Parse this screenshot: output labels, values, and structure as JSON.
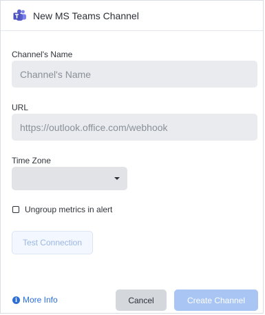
{
  "dialog": {
    "title": "New MS Teams Channel",
    "icon": "ms-teams-logo-icon"
  },
  "form": {
    "channel_name": {
      "label": "Channel's Name",
      "value": "",
      "placeholder": "Channel's Name"
    },
    "url": {
      "label": "URL",
      "value": "",
      "placeholder": "https://outlook.office.com/webhook"
    },
    "time_zone": {
      "label": "Time Zone",
      "selected": ""
    },
    "ungroup_metrics": {
      "label": "Ungroup metrics in alert",
      "checked": false
    },
    "test_connection_label": "Test Connection"
  },
  "footer": {
    "more_info_label": "More Info",
    "more_info_icon": "info-icon",
    "cancel_label": "Cancel",
    "create_label": "Create Channel"
  },
  "colors": {
    "teams_purple": "#5b5fc7",
    "link_blue": "#2c6fd6",
    "primary_disabled": "#a8c5f4",
    "input_bg": "#e9ebee"
  }
}
